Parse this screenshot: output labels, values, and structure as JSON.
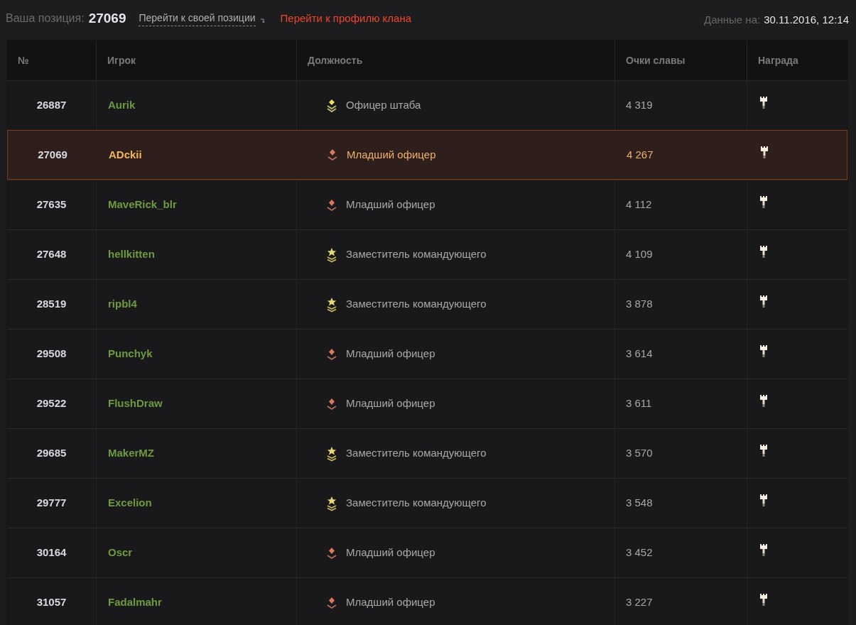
{
  "header": {
    "position_label": "Ваша позиция:",
    "position_value": "27069",
    "goto_position_link": "Перейти к своей позиции",
    "clan_profile_link": "Перейти к профилю клана",
    "data_label": "Данные на:",
    "data_value": "30.11.2016, 12:14"
  },
  "table": {
    "columns": [
      "№",
      "Игрок",
      "Должность",
      "Очки славы",
      "Награда"
    ],
    "rows": [
      {
        "number": "26887",
        "player": "Aurik",
        "rank": {
          "kind": "staff",
          "title": "Офицер штаба"
        },
        "fame_points": "4 319",
        "selected": false
      },
      {
        "number": "27069",
        "player": "ADckii",
        "rank": {
          "kind": "junior",
          "title": "Младший офицер"
        },
        "fame_points": "4 267",
        "selected": true
      },
      {
        "number": "27635",
        "player": "MaveRick_blr",
        "rank": {
          "kind": "junior",
          "title": "Младший офицер"
        },
        "fame_points": "4 112",
        "selected": false
      },
      {
        "number": "27648",
        "player": "hellkitten",
        "rank": {
          "kind": "deputy",
          "title": "Заместитель командующего"
        },
        "fame_points": "4 109",
        "selected": false
      },
      {
        "number": "28519",
        "player": "ripbl4",
        "rank": {
          "kind": "deputy",
          "title": "Заместитель командующего"
        },
        "fame_points": "3 878",
        "selected": false
      },
      {
        "number": "29508",
        "player": "Punchyk",
        "rank": {
          "kind": "junior",
          "title": "Младший офицер"
        },
        "fame_points": "3 614",
        "selected": false
      },
      {
        "number": "29522",
        "player": "FlushDraw",
        "rank": {
          "kind": "junior",
          "title": "Младший офицер"
        },
        "fame_points": "3 611",
        "selected": false
      },
      {
        "number": "29685",
        "player": "MakerMZ",
        "rank": {
          "kind": "deputy",
          "title": "Заместитель командующего"
        },
        "fame_points": "3 570",
        "selected": false
      },
      {
        "number": "29777",
        "player": "Excelion",
        "rank": {
          "kind": "deputy",
          "title": "Заместитель командующего"
        },
        "fame_points": "3 548",
        "selected": false
      },
      {
        "number": "30164",
        "player": "Oscr",
        "rank": {
          "kind": "junior",
          "title": "Младший офицер"
        },
        "fame_points": "3 452",
        "selected": false
      },
      {
        "number": "31057",
        "player": "Fadalmahr",
        "rank": {
          "kind": "junior",
          "title": "Младший офицер"
        },
        "fame_points": "3 227",
        "selected": false
      }
    ]
  }
}
